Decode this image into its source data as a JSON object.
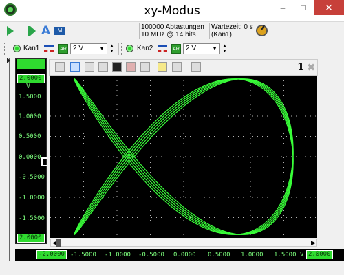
{
  "window": {
    "title": "xy-Modus",
    "minimize": "–",
    "maximize": "□",
    "close": "✕"
  },
  "toolbar": {
    "start_icon": "play-icon",
    "single_icon": "single-shot-icon",
    "auto_icon": "A",
    "measure_icon": "M",
    "samples": "100000 Abtastungen",
    "rate": "10 MHz @ 14 bits",
    "wait_label": "Wartezeit: 0 s",
    "wait_channel": "(Kan1)"
  },
  "channels": [
    {
      "label": "Kan1",
      "range": "2 V",
      "ar": "AR",
      "led_color": "#2bd62b"
    },
    {
      "label": "Kan2",
      "range": "2 V",
      "ar": "AR",
      "led_color": "#2bd62b"
    }
  ],
  "scope": {
    "page": "1",
    "close": "✖"
  },
  "y_axis": {
    "unit": "V",
    "top": "2.0000",
    "bottom": "2.0000",
    "ticks": [
      "1.5000",
      "1.0000",
      "0.5000",
      "0.0000",
      "-0.5000",
      "-1.0000",
      "-1.5000"
    ]
  },
  "x_axis": {
    "unit": "V",
    "left": "-2.0000",
    "right": "2.0000",
    "ticks": [
      "-1.5000",
      "-1.0000",
      "-0.5000",
      "0.0000",
      "0.5000",
      "1.0000",
      "1.5000"
    ]
  },
  "colors": {
    "trace": "#39ff39",
    "plot_bg": "#000000",
    "grid": "#b0b0b0"
  }
}
